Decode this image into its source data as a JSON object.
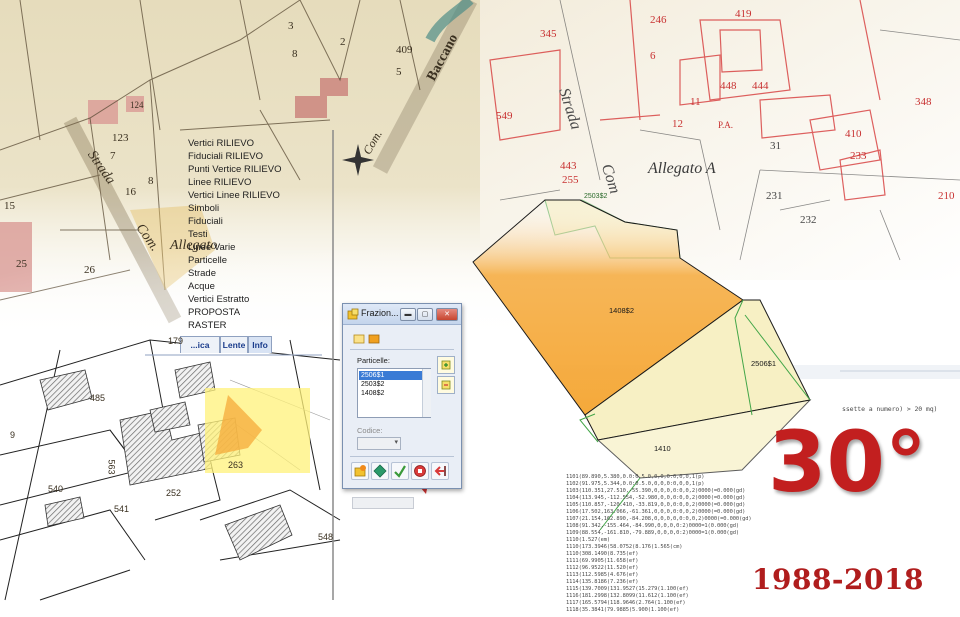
{
  "left_panel": {
    "layers": [
      "Vertici RILIEVO",
      "Fiduciali RILIEVO",
      "Punti Vertice RILIEVO",
      "Linee RILIEVO",
      "Vertici Linee RILIEVO",
      "Simboli",
      "Fiduciali",
      "Testi",
      "Linee Varie",
      "Particelle",
      "Strade",
      "Acque",
      "Vertici Estratto",
      "PROPOSTA",
      "RASTER"
    ],
    "tabs": [
      "...ica",
      "Lente",
      "Info"
    ]
  },
  "map": {
    "old_map_labels": [
      "123",
      "124",
      "7",
      "8",
      "16",
      "26",
      "25",
      "15",
      "8",
      "2",
      "3",
      "409",
      "5"
    ],
    "road_labels": [
      "Strada",
      "Com.",
      "Allegato",
      "Strada",
      "Com",
      "Allegato A",
      "Com.",
      "Baccano"
    ],
    "redline_labels": [
      "345",
      "246",
      "419",
      "6",
      "11",
      "12",
      "448",
      "444",
      "549",
      "443",
      "255",
      "31",
      "231",
      "232",
      "233",
      "P.A.",
      "410",
      "348",
      "210"
    ],
    "parcel_labels": [
      "179",
      "485",
      "9",
      "563",
      "540",
      "541",
      "252",
      "263",
      "548"
    ],
    "cad_labels": {
      "top": "2503$2",
      "orange": "1408$2",
      "right": "2506$1",
      "bottom": "1410"
    }
  },
  "dialog": {
    "title": "Frazion...",
    "group_label": "Particelle:",
    "list_items": [
      "2506$1",
      "2503$2",
      "1408$2"
    ],
    "selected_index": 0,
    "code_label": "Codice:",
    "code_value": ""
  },
  "terminal_lines": [
    "ssette a numero) > 20 mq)",
    "1101(89.890,5.380,0.0:0.5.0,0,0,0:0,0,0,1(p)",
    "1102(91.975,5.344,0.0:0.5.0,0,0,0:0,0,0,1(p)",
    "1103(110.351,27.510,-55.390,0,0,0,0:0,0,2)0000(=0.000(gd)",
    "1104(113.945,-112.554,-52.980,0,0,0:0,0,2)0000(=0.000(gd)",
    "1105(110.857,-120.410,-33.819,0,0,0:0,0,2)0000(=0.000(gd)",
    "1106(17.502,163.066,-61.361,0,0,0,0:0,0,2)0000(=0.000(gd)",
    "1107(21.154,162.890,-84.208,0,0,0,0,0:0,0,2)0000(=0.000(gd)",
    "1108(91.342,-155.464,-84.990,0,0,0,0:2)0000=1(0.000(gd)",
    "1109(88.554,-161.810,-79.889,0,0,0,0:2)0000=1(0.000(gd)",
    "1110(1.527(em)",
    "1110(173.3946(58.0752(8.176(1.565(cm)",
    "1110(308.1490(8.735(ef)",
    "1111(69.9905(11.658(ef)",
    "1112(96.9522(11.520(ef)",
    "1113(112.5985(4.676(ef)",
    "1114(135.8186(7.236(ef)",
    "1115(139.7009(131.9527(15.279(1.100(ef)",
    "1116(181.2998(132.8099(11.612(1.100(ef)",
    "1117(165.5794(118.9646(2.764(1.100(ef)",
    "1118(35.3841(79.9885(5.900(1.100(ef)",
    "1120(1.565(cm)"
  ],
  "anniversary": {
    "number": "30°",
    "years": "1988-2018"
  },
  "colors": {
    "accent_red": "#c21f1f",
    "orange_parcel": "#f5a93a",
    "light_parcel": "#f7f0c4",
    "yellow_highlight": "#fff27a",
    "redline": "#d63a3a"
  }
}
